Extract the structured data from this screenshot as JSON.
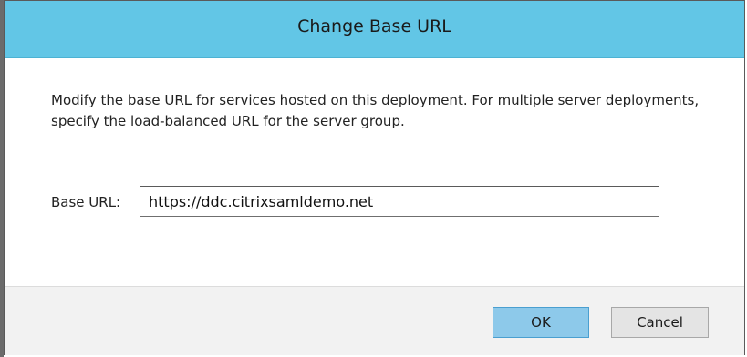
{
  "dialog": {
    "title": "Change Base URL",
    "description": "Modify the base URL for services hosted on this deployment. For multiple server deployments, specify the load-balanced URL for the server group.",
    "base_url": {
      "label": "Base URL:",
      "value": "https://ddc.citrixsamldemo.net"
    },
    "buttons": {
      "ok_label": "OK",
      "cancel_label": "Cancel"
    }
  },
  "colors": {
    "title_bar": "#62c6e6",
    "ok_button": "#8dc9ea",
    "footer": "#f2f2f2"
  }
}
